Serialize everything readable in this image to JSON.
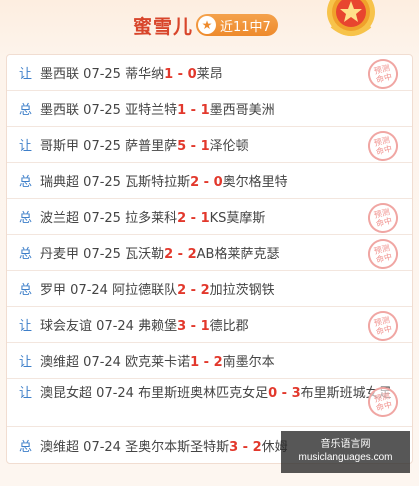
{
  "header": {
    "title": "蜜雪儿",
    "badge_text": "近11中7"
  },
  "matches": [
    {
      "type": "让",
      "league": "墨西联",
      "date": "07-25",
      "home": "蒂华纳",
      "home_score": "1",
      "sep": " - ",
      "away_score": "0",
      "away": "莱昂",
      "stamp": true
    },
    {
      "type": "总",
      "league": "墨西联",
      "date": "07-25",
      "home": "亚特兰特",
      "home_score": "1",
      "sep": " - ",
      "away_score": "1",
      "away": "墨西哥美洲",
      "stamp": false
    },
    {
      "type": "让",
      "league": "哥斯甲",
      "date": "07-25",
      "home": "萨普里萨",
      "home_score": "5",
      "sep": " - ",
      "away_score": "1",
      "away": "泽伦顿",
      "stamp": true
    },
    {
      "type": "总",
      "league": "瑞典超",
      "date": "07-25",
      "home": "瓦斯特拉斯",
      "home_score": "2",
      "sep": " - ",
      "away_score": "0",
      "away": "奥尔格里特",
      "stamp": false
    },
    {
      "type": "总",
      "league": "波兰超",
      "date": "07-25",
      "home": "拉多莱科",
      "home_score": "2",
      "sep": " - ",
      "away_score": "1",
      "away": "KS莫摩斯",
      "stamp": true
    },
    {
      "type": "总",
      "league": "丹麦甲",
      "date": "07-25",
      "home": "瓦沃勒",
      "home_score": "2",
      "sep": " - ",
      "away_score": "2",
      "away": "AB格莱萨克瑟",
      "stamp": true
    },
    {
      "type": "总",
      "league": "罗甲",
      "date": "07-24",
      "home": "阿拉德联队",
      "home_score": "2",
      "sep": " - ",
      "away_score": "2",
      "away": "加拉茨钢铁",
      "stamp": false
    },
    {
      "type": "让",
      "league": "球会友谊",
      "date": "07-24",
      "home": "弗赖堡",
      "home_score": "3",
      "sep": " - ",
      "away_score": "1",
      "away": "德比郡",
      "stamp": true
    },
    {
      "type": "让",
      "league": "澳维超",
      "date": "07-24",
      "home": "欧克莱卡诺",
      "home_score": "1",
      "sep": " - ",
      "away_score": "2",
      "away": "南墨尔本",
      "stamp": false
    },
    {
      "type": "让",
      "league": "澳昆女超",
      "date": "07-24",
      "home": "布里斯班奥林匹克女足",
      "home_score": "0",
      "sep": " - ",
      "away_score": "3",
      "away": "布里斯班城女足",
      "stamp": true
    },
    {
      "type": "总",
      "league": "澳维超",
      "date": "07-24",
      "home": "圣奥尔本斯圣特斯",
      "home_score": "3",
      "sep": " - ",
      "away_score": "2",
      "away": "休姆",
      "stamp": false
    }
  ],
  "stamp_text": [
    "预测",
    "命中"
  ],
  "watermark": {
    "top": "音乐语言网",
    "bottom": "musiclanguages.com"
  },
  "colors": {
    "title": "#d8452b",
    "badge": "#ee8a2c",
    "type_label": "#3e7fc9",
    "score": "#e2382c",
    "stamp": "#f08f8b"
  }
}
